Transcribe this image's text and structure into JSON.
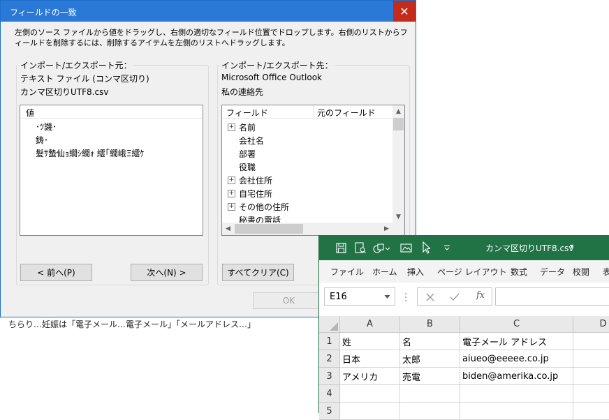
{
  "background": {
    "partial_text": "ちらり…妊娠は「電子メール…電子メール」「メールアドレス…」"
  },
  "dialog": {
    "title": "フィールドの一致",
    "close_glyph": "✕",
    "instruction": "左側のソース ファイルから値をドラッグし、右側の適切なフィールド位置でドロップします。右側のリストからフィールドを削除するには、削除するアイテムを左側のリストへドラッグします。",
    "source": {
      "group_label": "インポート/エクスポート元：",
      "file_type": "テキスト ファイル (コンマ区切り)",
      "file_name": "カンマ区切りUTF8.csv",
      "list_header": "値",
      "items": [
        "･ﾂ譏･",
        "鋳･",
        "髮ｻ蟄仙ｮ繝ｼ繝ｫ 繧｢繝峨Ξ繧ｹ"
      ]
    },
    "destination": {
      "group_label": "インポート/エクスポート先：",
      "app": "Microsoft Office Outlook",
      "folder": "私の連絡先",
      "col_field": "フィールド",
      "col_original": "元のフィールド",
      "items": [
        {
          "label": "名前",
          "expandable": true
        },
        {
          "label": "会社名",
          "expandable": false
        },
        {
          "label": "部署",
          "expandable": false
        },
        {
          "label": "役職",
          "expandable": false
        },
        {
          "label": "会社住所",
          "expandable": true
        },
        {
          "label": "自宅住所",
          "expandable": true
        },
        {
          "label": "その他の住所",
          "expandable": true
        },
        {
          "label": "秘書の電話",
          "expandable": false
        }
      ]
    },
    "buttons": {
      "prev": "< 前へ(P)",
      "next": "次へ(N) >",
      "clear_all": "すべてクリア(C)",
      "ok": "OK"
    }
  },
  "excel": {
    "file_title": "カンマ区切りUTF8.csv",
    "title_caret": "▾",
    "ribbon_tabs": [
      "ファイル",
      "ホーム",
      "挿入",
      "ページ レイアウト",
      "数式",
      "データ",
      "校閲",
      "表"
    ],
    "name_box": "E16",
    "formula_value": "",
    "columns": [
      "A",
      "B",
      "C",
      "D"
    ],
    "rows": [
      {
        "num": "1",
        "cells": [
          "姓",
          "名",
          "電子メール アドレス",
          ""
        ]
      },
      {
        "num": "2",
        "cells": [
          "日本",
          "太郎",
          "aiueo@eeeee.co.jp",
          ""
        ]
      },
      {
        "num": "3",
        "cells": [
          "アメリカ",
          "売電",
          "biden@amerika.co.jp",
          ""
        ]
      },
      {
        "num": "4",
        "cells": [
          "",
          "",
          "",
          ""
        ]
      },
      {
        "num": "5",
        "cells": [
          "",
          "",
          "",
          ""
        ]
      }
    ],
    "colors": {
      "title_bar": "#217346",
      "dialog_title": "#2b79d6",
      "close": "#c42b1c"
    }
  }
}
